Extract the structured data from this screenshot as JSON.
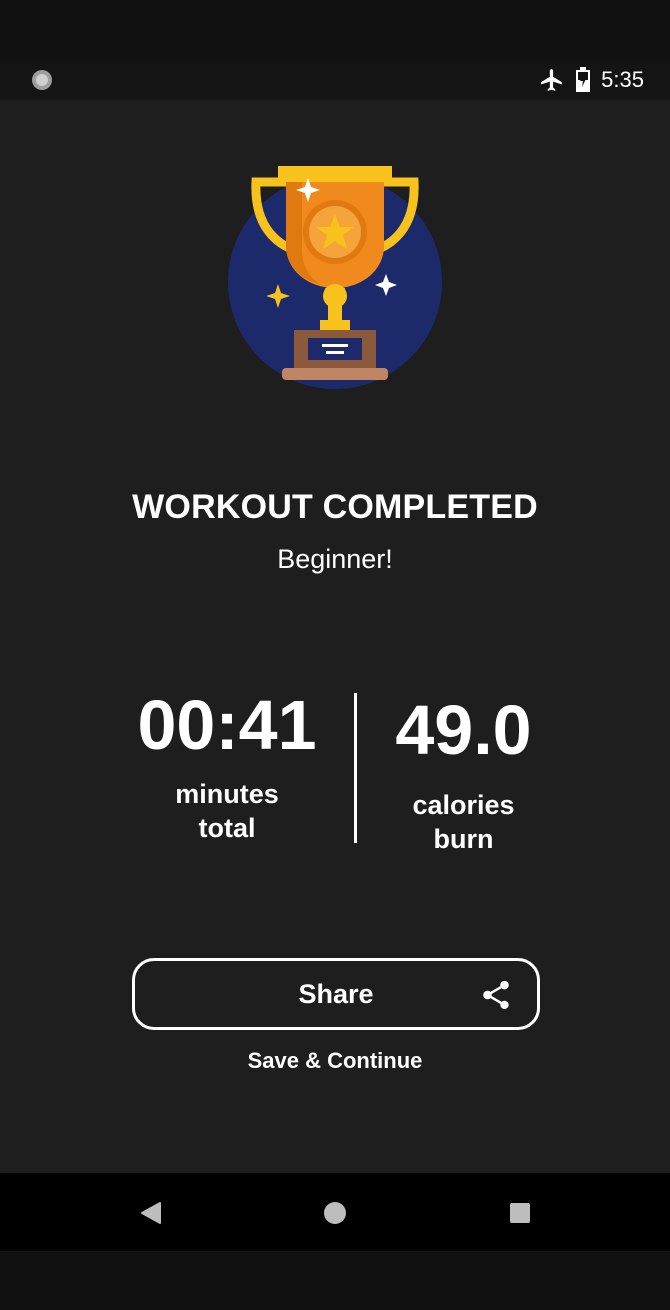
{
  "status_bar": {
    "time": "5:35",
    "icons": [
      "loading-icon",
      "airplane-mode-icon",
      "battery-icon"
    ]
  },
  "result": {
    "title": "WORKOUT COMPLETED",
    "level": "Beginner!"
  },
  "stats": {
    "duration": {
      "value": "00:41",
      "label_line1": "minutes",
      "label_line2": "total"
    },
    "calories": {
      "value": "49.0",
      "label_line1": "calories",
      "label_line2": "burn"
    }
  },
  "actions": {
    "share_label": "Share",
    "save_continue_label": "Save & Continue"
  },
  "navigation": {
    "icons": [
      "back-icon",
      "home-icon",
      "recent-apps-icon"
    ]
  },
  "colors": {
    "background": "#1e1e1e",
    "trophy_gold": "#f8c21c",
    "trophy_orange": "#f08a1d",
    "badge_navy": "#1c2a6b",
    "text": "#ffffff"
  }
}
